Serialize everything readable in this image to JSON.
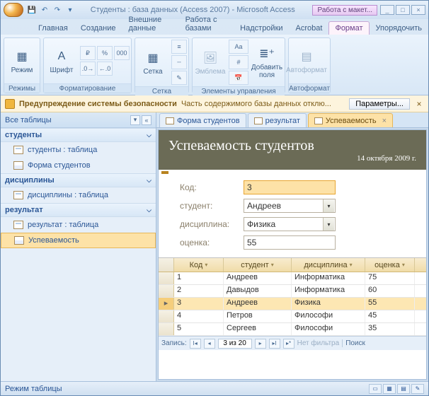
{
  "titlebar": {
    "title": "Студенты : база данных (Access 2007) - Microsoft Access",
    "context_tab": "Работа с макет..."
  },
  "tabs": [
    "Главная",
    "Создание",
    "Внешние данные",
    "Работа с базами",
    "Надстройки",
    "Acrobat",
    "Формат",
    "Упорядочить"
  ],
  "ribbon": {
    "view": "Режим",
    "font": "Шрифт",
    "grid": "Сетка",
    "emblem": "Эмблема",
    "addfield": "Добавить поля",
    "autoformat": "Автоформат",
    "g_views": "Режимы",
    "g_format": "Форматирование",
    "g_grid": "Сетка",
    "g_controls": "Элементы управления",
    "g_autofmt": "Автоформат"
  },
  "security": {
    "title": "Предупреждение системы безопасности",
    "msg": "Часть содержимого базы данных отклю...",
    "btn": "Параметры..."
  },
  "nav": {
    "header": "Все таблицы",
    "groups": [
      {
        "title": "студенты",
        "items": [
          {
            "label": "студенты : таблица",
            "type": "tbl"
          },
          {
            "label": "Форма студентов",
            "type": "frm"
          }
        ]
      },
      {
        "title": "дисциплины",
        "items": [
          {
            "label": "дисциплины : таблица",
            "type": "tbl"
          }
        ]
      },
      {
        "title": "результат",
        "items": [
          {
            "label": "результат : таблица",
            "type": "tbl"
          },
          {
            "label": "Успеваемость",
            "type": "frm",
            "sel": true
          }
        ]
      }
    ]
  },
  "doc_tabs": [
    {
      "label": "Форма студентов"
    },
    {
      "label": "результат"
    },
    {
      "label": "Успеваемость",
      "active": true
    }
  ],
  "form": {
    "title": "Успеваемость студентов",
    "date": "14 октября 2009 г.",
    "fields": {
      "kod_label": "Код:",
      "kod_value": "3",
      "stud_label": "студент:",
      "stud_value": "Андреев",
      "disc_label": "дисциплина:",
      "disc_value": "Физика",
      "oc_label": "оценка:",
      "oc_value": "55"
    }
  },
  "datasheet": {
    "cols": [
      "Код",
      "студент",
      "дисциплина",
      "оценка"
    ],
    "rows": [
      {
        "n": "1",
        "s": "Андреев",
        "d": "Информатика",
        "o": "75"
      },
      {
        "n": "2",
        "s": "Давыдов",
        "d": "Информатика",
        "o": "60"
      },
      {
        "n": "3",
        "s": "Андреев",
        "d": "Физика",
        "o": "55",
        "sel": true
      },
      {
        "n": "4",
        "s": "Петров",
        "d": "Философи",
        "o": "45"
      },
      {
        "n": "5",
        "s": "Сергеев",
        "d": "Философи",
        "o": "35"
      }
    ]
  },
  "recnav": {
    "label": "Запись:",
    "pos": "3 из 20",
    "nofilter": "Нет фильтра",
    "search": "Поиск"
  },
  "statusbar": "Режим таблицы"
}
